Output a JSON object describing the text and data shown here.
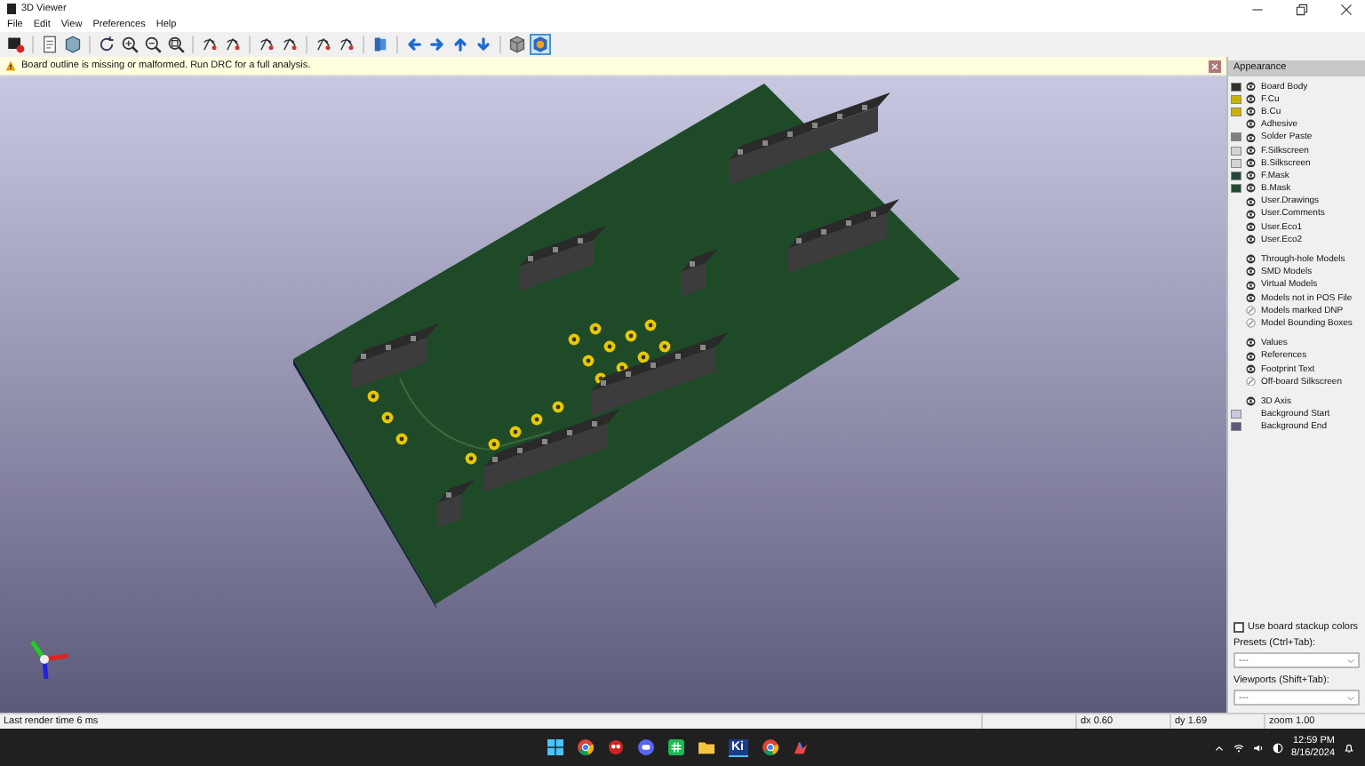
{
  "window": {
    "title": "3D Viewer"
  },
  "menu": [
    "File",
    "Edit",
    "View",
    "Preferences",
    "Help"
  ],
  "toolbar": [
    {
      "kind": "render",
      "selected": false
    },
    {
      "kind": "sep"
    },
    {
      "kind": "copy",
      "selected": false
    },
    {
      "kind": "board",
      "selected": false
    },
    {
      "kind": "sep"
    },
    {
      "kind": "refresh",
      "selected": false
    },
    {
      "kind": "zoom-in",
      "selected": false
    },
    {
      "kind": "zoom-out",
      "selected": false
    },
    {
      "kind": "zoom-fit",
      "selected": false
    },
    {
      "kind": "sep"
    },
    {
      "kind": "rotate",
      "selected": false
    },
    {
      "kind": "rotate",
      "selected": false
    },
    {
      "kind": "sep"
    },
    {
      "kind": "rotate",
      "selected": false
    },
    {
      "kind": "rotate",
      "selected": false
    },
    {
      "kind": "sep"
    },
    {
      "kind": "rotate",
      "selected": false
    },
    {
      "kind": "rotate",
      "selected": false
    },
    {
      "kind": "sep"
    },
    {
      "kind": "flip",
      "selected": false
    },
    {
      "kind": "sep"
    },
    {
      "kind": "left",
      "selected": false
    },
    {
      "kind": "right",
      "selected": false
    },
    {
      "kind": "up",
      "selected": false
    },
    {
      "kind": "down",
      "selected": false
    },
    {
      "kind": "sep"
    },
    {
      "kind": "box",
      "selected": false
    },
    {
      "kind": "ortho",
      "selected": true
    }
  ],
  "infobar": {
    "message": "Board outline is missing or malformed. Run DRC for a full analysis."
  },
  "appearance": {
    "title": "Appearance",
    "groups": [
      [
        {
          "name": "Board Body",
          "color": "#33332a",
          "visible": true
        },
        {
          "name": "F.Cu",
          "color": "#c8b400",
          "visible": true
        },
        {
          "name": "B.Cu",
          "color": "#c8b400",
          "visible": true
        },
        {
          "name": "Adhesive",
          "visible": true
        },
        {
          "name": "Solder Paste",
          "color": "#808080",
          "visible": true
        },
        {
          "name": "F.Silkscreen",
          "color": "#d4d4d4",
          "visible": true
        },
        {
          "name": "B.Silkscreen",
          "color": "#d4d4d4",
          "visible": true
        },
        {
          "name": "F.Mask",
          "color": "#234a36",
          "visible": true
        },
        {
          "name": "B.Mask",
          "color": "#234a36",
          "visible": true
        },
        {
          "name": "User.Drawings",
          "visible": true
        },
        {
          "name": "User.Comments",
          "visible": true
        },
        {
          "name": "User.Eco1",
          "visible": true
        },
        {
          "name": "User.Eco2",
          "visible": true
        }
      ],
      [
        {
          "name": "Through-hole Models",
          "visible": true
        },
        {
          "name": "SMD Models",
          "visible": true
        },
        {
          "name": "Virtual Models",
          "visible": true
        },
        {
          "name": "Models not in POS File",
          "visible": true
        },
        {
          "name": "Models marked DNP",
          "visible": false
        },
        {
          "name": "Model Bounding Boxes",
          "visible": false
        }
      ],
      [
        {
          "name": "Values",
          "visible": true
        },
        {
          "name": "References",
          "visible": true
        },
        {
          "name": "Footprint Text",
          "visible": true
        },
        {
          "name": "Off-board Silkscreen",
          "visible": false
        }
      ],
      [
        {
          "name": "3D Axis",
          "visible": true
        },
        {
          "name": "Background Start",
          "color": "#c8c8e2"
        },
        {
          "name": "Background End",
          "color": "#5c5a7a"
        }
      ]
    ],
    "stackup": {
      "label": "Use board stackup colors",
      "checked": false
    },
    "presets": {
      "label": "Presets (Ctrl+Tab):",
      "value": "---"
    },
    "viewports": {
      "label": "Viewports (Shift+Tab):",
      "value": "---"
    }
  },
  "status_bar": [
    "Last render time 6 ms",
    "dx 0.60",
    "dy 1.69",
    "zoom 1.00"
  ],
  "taskbar": {
    "app_label": "Ki",
    "time": "12:59 PM",
    "date": "8/16/2024"
  }
}
